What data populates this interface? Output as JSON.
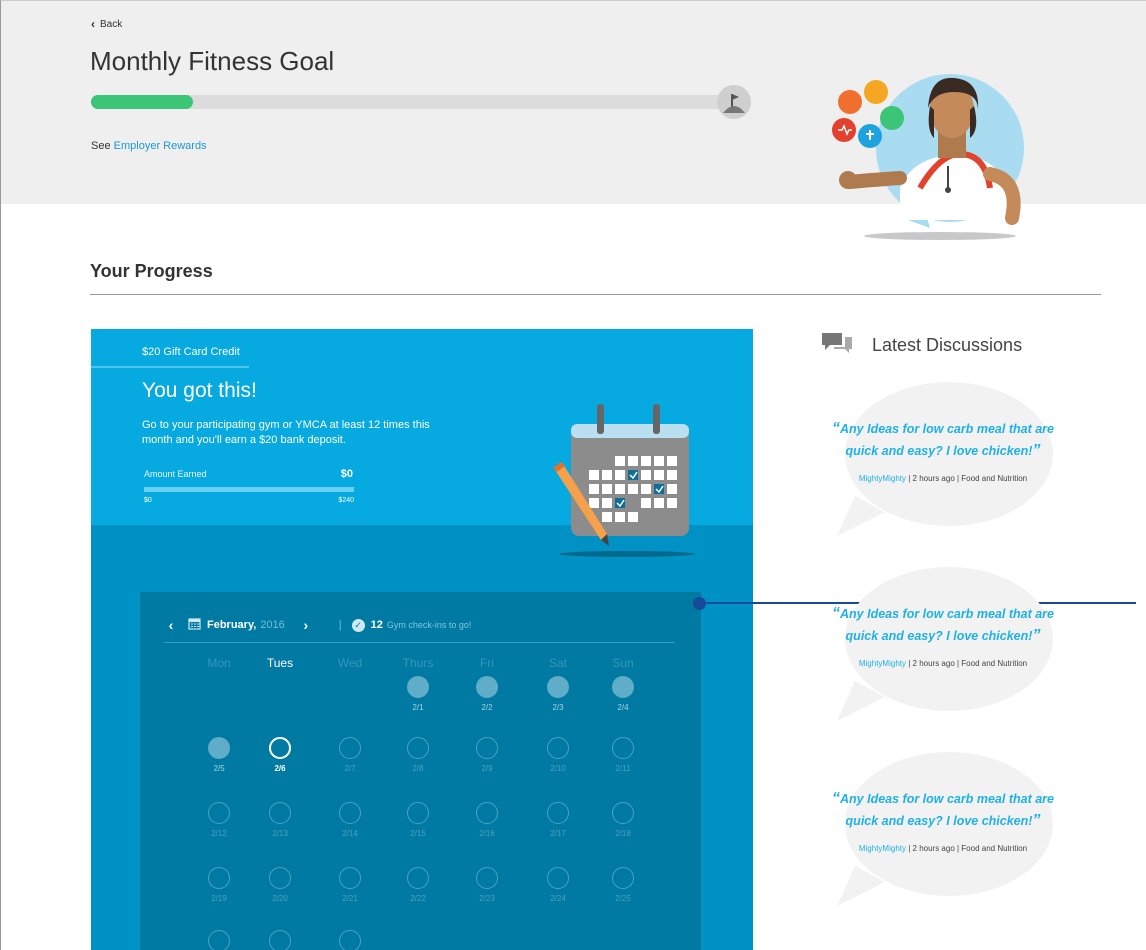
{
  "header": {
    "back_label": "Back",
    "title": "Monthly Fitness Goal",
    "goal_progress": 0.16,
    "see_prefix": "See",
    "rewards_link": "Employer Rewards"
  },
  "progress": {
    "section_title": "Your Progress"
  },
  "card": {
    "credit_label": "$20 Gift Card Credit",
    "heading": "You got this!",
    "description": "Go to your participating gym or YMCA at least 12 times this month and you'll earn a $20 bank deposit.",
    "amount_label": "Amount Earned",
    "amount_value": "$0",
    "range_min": "$0",
    "range_max": "$240"
  },
  "calendar": {
    "month": "February,",
    "year": "2016",
    "checkin_count": "12",
    "checkin_text": "Gym check-ins to go!",
    "day_names": [
      "Mon",
      "Tues",
      "Wed",
      "Thurs",
      "Fri",
      "Sat",
      "Sun"
    ],
    "active_day_index": 1,
    "weeks": [
      [
        {
          "d": ""
        },
        {
          "d": ""
        },
        {
          "d": ""
        },
        {
          "d": "2/1",
          "s": "past"
        },
        {
          "d": "2/2",
          "s": "past"
        },
        {
          "d": "2/3",
          "s": "past"
        },
        {
          "d": "2/4",
          "s": "past"
        }
      ],
      [
        {
          "d": "2/5",
          "s": "past"
        },
        {
          "d": "2/6",
          "s": "today"
        },
        {
          "d": "2/7",
          "s": "open"
        },
        {
          "d": "2/8",
          "s": "open"
        },
        {
          "d": "2/9",
          "s": "open"
        },
        {
          "d": "2/10",
          "s": "open"
        },
        {
          "d": "2/11",
          "s": "open"
        }
      ],
      [
        {
          "d": "2/12",
          "s": "open"
        },
        {
          "d": "2/13",
          "s": "open"
        },
        {
          "d": "2/14",
          "s": "open"
        },
        {
          "d": "2/15",
          "s": "open"
        },
        {
          "d": "2/16",
          "s": "open"
        },
        {
          "d": "2/17",
          "s": "open"
        },
        {
          "d": "2/18",
          "s": "open"
        }
      ],
      [
        {
          "d": "2/19",
          "s": "open"
        },
        {
          "d": "2/20",
          "s": "open"
        },
        {
          "d": "2/21",
          "s": "open"
        },
        {
          "d": "2/22",
          "s": "open"
        },
        {
          "d": "2/23",
          "s": "open"
        },
        {
          "d": "2/24",
          "s": "open"
        },
        {
          "d": "2/25",
          "s": "open"
        }
      ],
      [
        {
          "d": "",
          "s": "open"
        },
        {
          "d": "",
          "s": "open"
        },
        {
          "d": "",
          "s": "open"
        }
      ]
    ]
  },
  "discussions": {
    "title": "Latest Discussions",
    "items": [
      {
        "quote": "Any Ideas for low carb meal that are quick and easy? I love chicken!",
        "user": "MightyMighty",
        "meta": "| 2 hours ago | Food and Nutrition"
      },
      {
        "quote": "Any Ideas for low carb meal that are quick and easy? I love chicken!",
        "user": "MightyMighty",
        "meta": "| 2 hours ago | Food and Nutrition"
      },
      {
        "quote": "Any Ideas for low carb meal that are quick and easy? I love chicken!",
        "user": "MightyMighty",
        "meta": "| 2 hours ago | Food and Nutrition"
      }
    ]
  },
  "colors": {
    "accent": "#1fb1e6",
    "goal_green": "#3cc477",
    "card_top": "#06a9e0",
    "card_bottom": "#0092c4",
    "calendar_bg": "#007aa3",
    "connector": "#174a99"
  }
}
